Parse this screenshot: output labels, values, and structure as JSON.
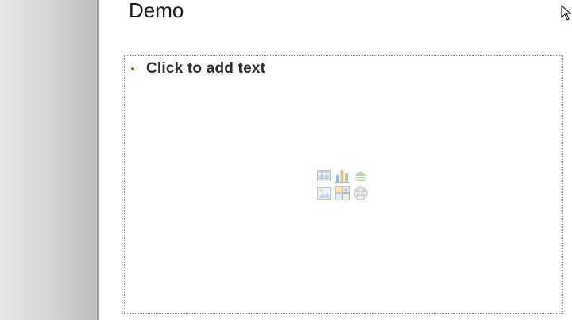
{
  "slide": {
    "title": "Demo",
    "content_placeholder": {
      "text": "Click to add text",
      "insert_icons": [
        "insert-table-icon",
        "insert-chart-icon",
        "insert-smartart-icon",
        "insert-picture-icon",
        "insert-clipart-icon",
        "insert-media-icon"
      ]
    }
  },
  "colors": {
    "bullet": "#6b7d2a",
    "gutter": "#cfcfcf"
  }
}
